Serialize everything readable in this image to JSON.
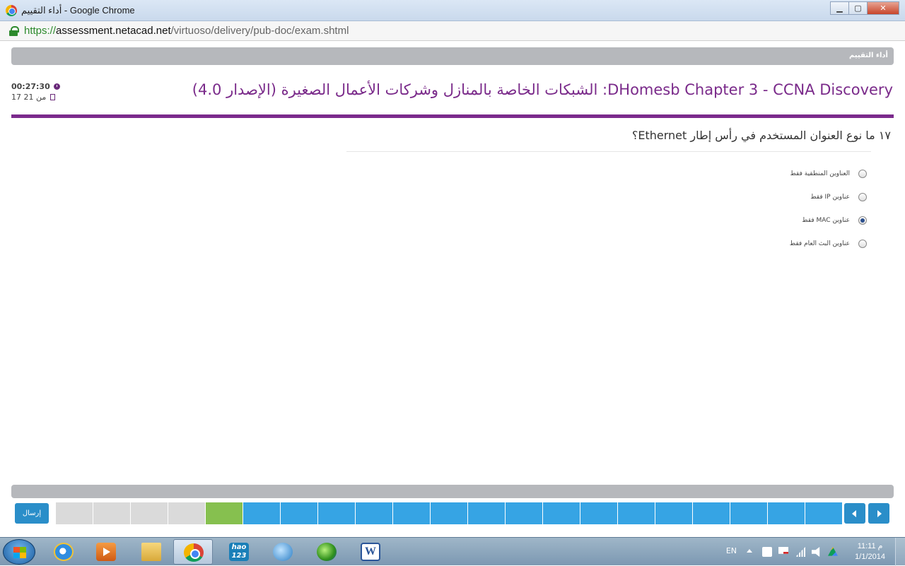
{
  "window": {
    "title": "أداء التقييم - Google Chrome",
    "buttons": {
      "minimize": "▁",
      "maximize": "▢",
      "close": "✕"
    }
  },
  "address": {
    "scheme": "https://",
    "host": "assessment.netacad.net",
    "path": "/virtuoso/delivery/pub-doc/exam.shtml"
  },
  "page": {
    "header_label": "أداء التقييم",
    "exam_title": "DHomesb Chapter 3 - CCNA Discovery: الشبكات الخاصة بالمنازل وشركات الأعمال الصغيرة (الإصدار 4.0)",
    "timer": "00:27:30",
    "page_count": "17 من 21"
  },
  "question": {
    "number": "١٧",
    "text": "ما نوع العنوان المستخدم في رأس إطار Ethernet؟",
    "options": [
      {
        "label": "العناوين المنطقية فقط",
        "checked": false
      },
      {
        "label": "عناوين IP فقط",
        "checked": false
      },
      {
        "label": "عناوين MAC فقط",
        "checked": true
      },
      {
        "label": "عناوين البث العام فقط",
        "checked": false
      }
    ]
  },
  "navigation": {
    "submit_label": "إرسال",
    "tiles": [
      "answered",
      "answered",
      "answered",
      "answered",
      "current",
      "open",
      "open",
      "open",
      "open",
      "open",
      "open",
      "open",
      "open",
      "open",
      "open",
      "open",
      "open",
      "open",
      "open",
      "open",
      "open"
    ],
    "colors": {
      "answered": "#dadada",
      "current": "#86c04f",
      "open": "#36a4e4"
    }
  },
  "taskbar": {
    "apps": [
      "start-button",
      "internet-explorer",
      "media-player",
      "file-explorer",
      "google-chrome",
      "hao123",
      "windows-update",
      "globe-browser",
      "microsoft-word"
    ],
    "hao_label": "hao\n123",
    "word_label": "W",
    "language": "EN",
    "time": "11:11 م",
    "date": "1/1/2014"
  }
}
